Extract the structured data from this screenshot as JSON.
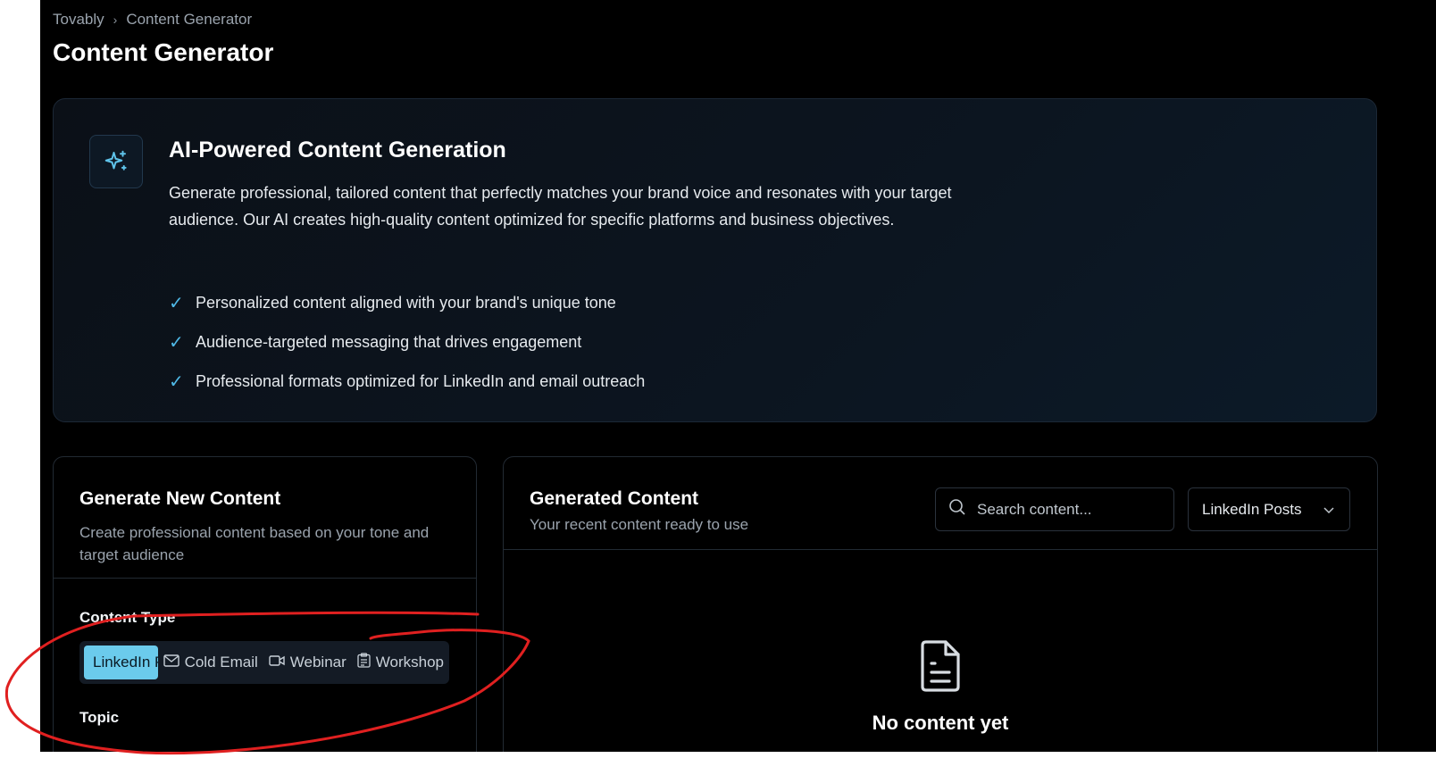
{
  "breadcrumb": {
    "root": "Tovably",
    "separator": "›",
    "current": "Content Generator"
  },
  "page": {
    "title": "Content Generator"
  },
  "hero": {
    "title": "AI-Powered Content Generation",
    "description": "Generate professional, tailored content that perfectly matches your brand voice and resonates with your target audience. Our AI creates high-quality content optimized for specific platforms and business objectives.",
    "features": [
      "Personalized content aligned with your brand's unique tone",
      "Audience-targeted messaging that drives engagement",
      "Professional formats optimized for LinkedIn and email outreach"
    ],
    "icon": "sparkles-icon"
  },
  "generate": {
    "title": "Generate New Content",
    "subtitle": "Create professional content based on your tone and target audience",
    "content_type_label": "Content Type",
    "topic_label": "Topic",
    "types": [
      {
        "label": "LinkedIn Posts",
        "icon": "linkedin-icon",
        "active": true
      },
      {
        "label": "Cold Email",
        "icon": "mail-icon",
        "active": false
      },
      {
        "label": "Webinar",
        "icon": "video-icon",
        "active": false
      },
      {
        "label": "Workshop",
        "icon": "clipboard-icon",
        "active": false
      }
    ]
  },
  "generated": {
    "title": "Generated Content",
    "subtitle": "Your recent content ready to use",
    "search_placeholder": "Search content...",
    "filter_value": "LinkedIn Posts",
    "empty_title": "No content yet"
  },
  "colors": {
    "accent": "#6bcbec",
    "check": "#4fb8e6",
    "annotation": "#e02020"
  }
}
